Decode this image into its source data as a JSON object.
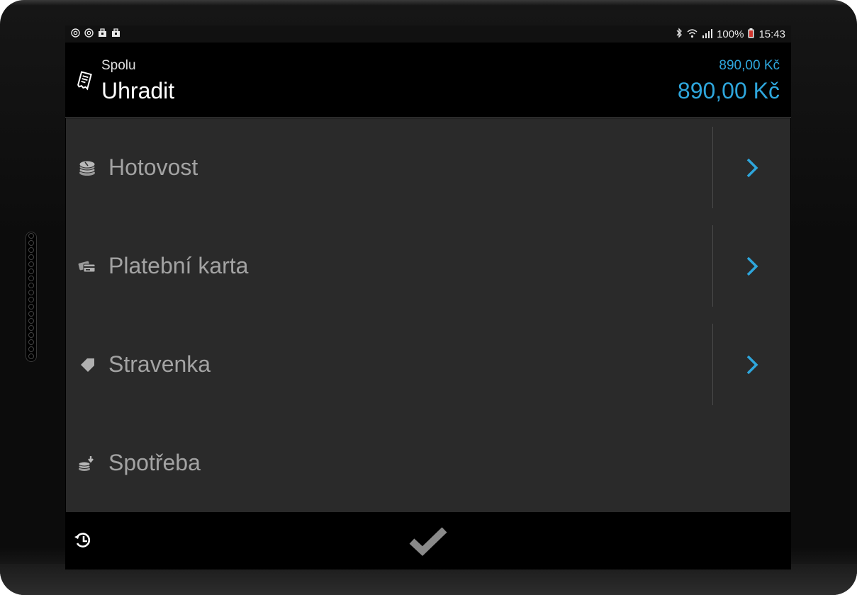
{
  "statusbar": {
    "notification_icons": [
      "at-icon",
      "at-icon",
      "briefcase-icon",
      "briefcase-icon"
    ],
    "right_icons": [
      "bluetooth-icon",
      "wifi-icon",
      "signal-icon"
    ],
    "battery": "100%",
    "time": "15:43"
  },
  "header": {
    "label": "Spolu",
    "title": "Uhradit",
    "amount_small": "890,00 Kč",
    "amount_large": "890,00 Kč",
    "icon": "receipt-icon"
  },
  "payment_methods": [
    {
      "label": "Hotovost",
      "icon": "coins-stack-icon",
      "has_chevron": true
    },
    {
      "label": "Platební karta",
      "icon": "cards-icon",
      "has_chevron": true
    },
    {
      "label": "Stravenka",
      "icon": "ticket-icon",
      "has_chevron": true
    },
    {
      "label": "Spotřeba",
      "icon": "coins-down-icon",
      "has_chevron": false
    }
  ],
  "bottombar": {
    "left_icon": "history-icon",
    "center_icon": "check-icon"
  },
  "colors": {
    "accent": "#2ea6dc",
    "list_background": "#2a2a2a",
    "label_gray": "#a3a3a3",
    "check_gray": "#8a8a8a"
  }
}
